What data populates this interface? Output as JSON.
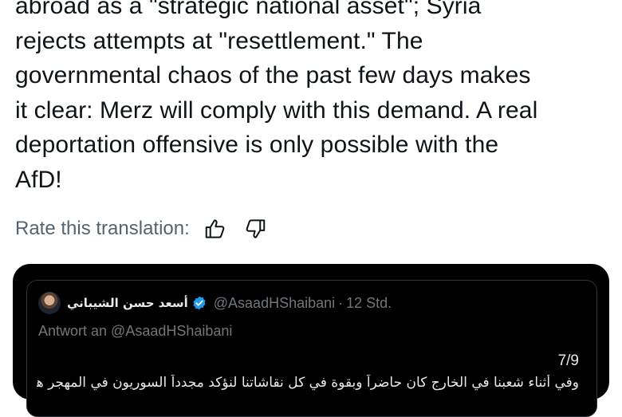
{
  "tweet": {
    "lines": [
      "abroad as a \"strategic national asset\"; Syria",
      "rejects attempts at \"resettlement.\" The",
      "governmental chaos of the past few days makes",
      "it clear: Merz will comply with this demand. A real",
      "deportation offensive is only possible with the",
      "AfD!"
    ]
  },
  "translation": {
    "rate_label": "Rate this translation:",
    "thumbs_up_icon": "thumbs-up-icon",
    "thumbs_down_icon": "thumbs-down-icon"
  },
  "quoted_tweet": {
    "author_name": "أسعد حسن الشيباني",
    "handle": "@AsaadHShaibani",
    "separator": "·",
    "time": "12 Std.",
    "reply_to": "Antwort an @AsaadHShaibani",
    "counter": "7/9",
    "body": "وفي أثناء شعبنا في الخارج كان حاضراً وبقوة في كل نقاشاتنا لنؤكد مجدداً السوريون في المهجر هم أصول وطنية",
    "colors": {
      "card_bg": "#000000",
      "border": "#2f3336",
      "text": "#e7e9ea",
      "muted": "#71767b",
      "verified": "#1d9bf0"
    }
  }
}
